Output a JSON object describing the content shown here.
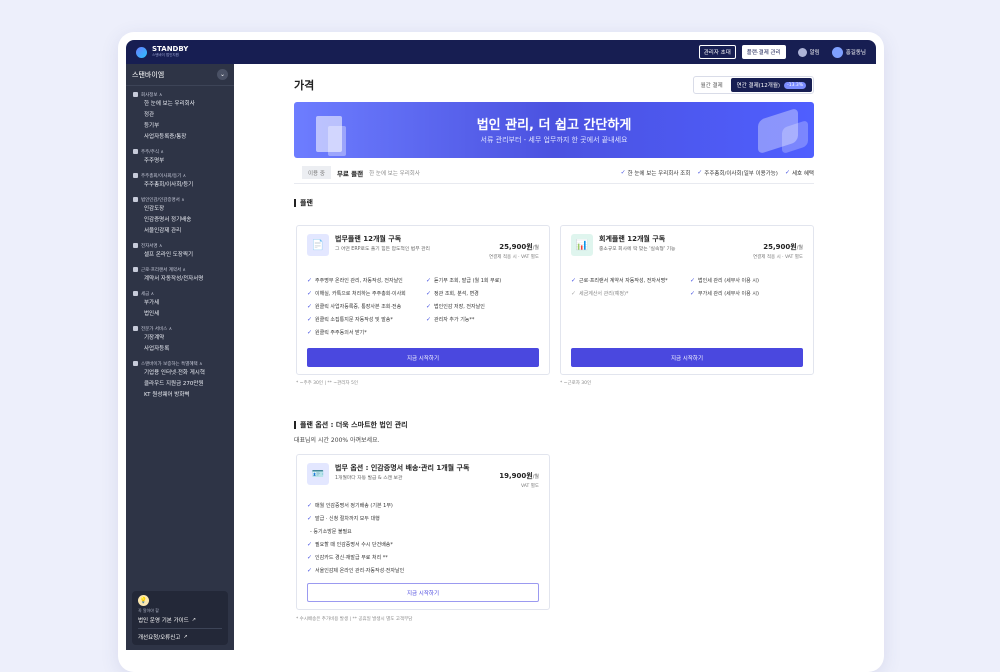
{
  "brand": {
    "name": "STANDBY",
    "tagline": "스탠바이 법인지원"
  },
  "topbar": {
    "invite": "관리자 초대",
    "billing": "플랜·결제 관리",
    "alarm": "알림",
    "user": "홍길동님"
  },
  "sidebar": {
    "company": "스탠바이엠",
    "sections": [
      {
        "title": "회사정보 ∧",
        "items": [
          "한 눈에 보는 우리회사",
          "정관",
          "등기부",
          "사업자등록증/통장"
        ]
      },
      {
        "title": "주주/주식 ∧",
        "items": [
          "주주명부"
        ]
      },
      {
        "title": "주주총회/이사회/등기 ∧",
        "items": [
          "주주총회/이사회/등기"
        ]
      },
      {
        "title": "법인인감/인감증명서 ∧",
        "items": [
          "인감도장",
          "인감증명서 정기배송",
          "서울인감제 관리"
        ]
      },
      {
        "title": "전자서명 ∧",
        "items": [
          "셀프 온라인 도장찍기"
        ]
      },
      {
        "title": "근로·프리랜서 계약서 ∧",
        "items": [
          "계약서 자동작성/전자서명"
        ]
      },
      {
        "title": "세금 ∧",
        "items": [
          "부가세",
          "법인세"
        ]
      },
      {
        "title": "전문가 서비스 ∧",
        "items": [
          "기장계약",
          "사업자등록"
        ]
      },
      {
        "title": "스탠바이가 보증하는 특별혜택 ∧",
        "items": [
          "기업용 인터넷·전화 게시혁",
          "클라우드 지원금 270만원",
          "KT 원성웨어 방화벽"
        ]
      }
    ],
    "box": {
      "bulb": "💡",
      "small": "꼭 알아야 할",
      "guide": "법인 운영 기본 가이드",
      "report": "개선요청/오류신고"
    }
  },
  "page": {
    "title": "가격",
    "billing_monthly": "월간 결제",
    "billing_yearly": "연간 결제(12개월)",
    "discount": "-13.3%"
  },
  "banner": {
    "title": "법인 관리, 더 쉽고 간단하게",
    "subtitle": "서류 관리부터 - 세무 업무까지 한 곳에서 끝내세요"
  },
  "free": {
    "chip": "이용 중",
    "name": "무료 플랜",
    "desc": "한 눈에 보는 우리회사",
    "features": [
      "한 눈에 보는 우리회사 조회",
      "주주총회/이사회(일부 이용가능)",
      "세호 혜택"
    ]
  },
  "plans_section": {
    "title": "플랜"
  },
  "plans": [
    {
      "icon": "📄",
      "title": "법무플랜 12개월 구독",
      "desc": "그 어떤 ERP로도 풀기 힘든 압도적인 법무 관리",
      "price": "25,900원",
      "unit": "/월",
      "vat": "연결제 적용 시 · VAT 별도",
      "features": [
        "주주명부 온라인 관리, 자동작성, 전자날인",
        "듣기부 조회, 발급 (월 1회 무료)",
        "이해실, 카톡으로 처리하는 주주총회·이사회",
        "정관 조회, 분석, 변경",
        "원클릭 사업자등록증, 통장사본 조회·전송",
        "법인인감 저장, 전자날인",
        "원클릭 소집통지문 자동작성 및 발송*",
        "관리자 추가 기능**",
        "원클릭 주주동의서 받기*"
      ],
      "muted": [],
      "button": "지금 시작하기",
      "footnote": "* ~주주 30인   |   ** ~관리자 5인"
    },
    {
      "icon": "📊",
      "title": "회계플랜 12개월 구독",
      "desc": "중소규모 회사에 딱 맞는 '실속형' 기능",
      "price": "25,900원",
      "unit": "/월",
      "vat": "연결제 적용 시 · VAT 별도",
      "features": [
        "근로·프리랜서 계약서 자동작성, 전자서명*",
        "법인세 관리 (세무사 이용 시)",
        "세금계산서 관리(예정)*",
        "부가세 관리 (세무사 이용 시)"
      ],
      "muted": [
        2
      ],
      "button": "지금 시작하기",
      "footnote": "* ~근로자 30인"
    }
  ],
  "option_section": {
    "title": "플랜 옵션 : 더욱 스마트한 법인 관리",
    "subtitle": "대표님의 시간 200% 아껴보세요."
  },
  "option": {
    "icon": "🪪",
    "title": "법무 옵션 : 인감증명서 배송·관리 1개월 구독",
    "desc": "1개월마다 자동 발급 & 스캔 보관",
    "price": "19,900원",
    "unit": "/월",
    "vat": "VAT 별도",
    "features": [
      "매월 인감증명서 정기배송 (기본 1부)",
      "발급 · 신청 절차까지 모두 대행",
      "- 등기소방문 불필요",
      "필요할 때 인감증명서 수시 단건배송*",
      "인감카드 경신·재발급 무료 처리 **",
      "서울인감제 온라인 관리·자동작성·전자날인"
    ],
    "button": "지금 시작하기",
    "footnote": "* 수시배송은 추가비용 발생   |   ** 공휴일 발생시 별도 고객부담"
  },
  "colors": {
    "primary": "#4a48df",
    "nav": "#171e52",
    "sidebar": "#2e3446"
  }
}
